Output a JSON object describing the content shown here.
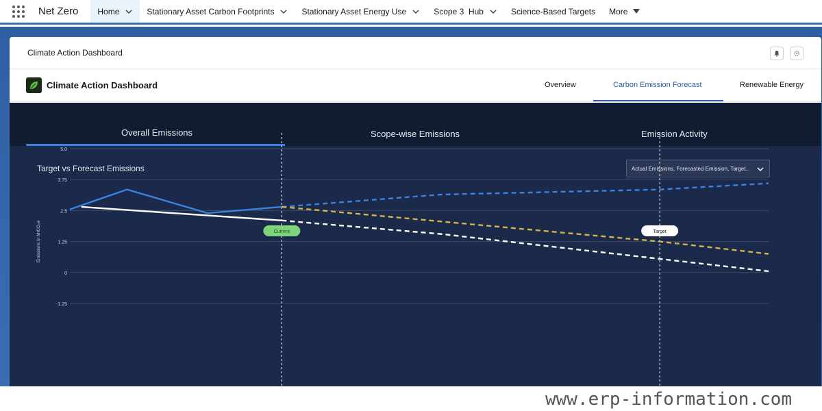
{
  "topnav": {
    "app_name": "Net Zero",
    "items": [
      {
        "label": "Home",
        "has_chevron": true
      },
      {
        "label": "Stationary Asset Carbon Footprints",
        "has_chevron": true
      },
      {
        "label": "Stationary Asset Energy Use",
        "has_chevron": true
      },
      {
        "label": "Scope 3  Hub",
        "has_chevron": true
      },
      {
        "label": "Science-Based Targets",
        "has_chevron": false
      },
      {
        "label": "More",
        "has_chevron": true
      }
    ]
  },
  "card": {
    "title": "Climate Action Dashboard",
    "icons": [
      "bell-icon",
      "settings-icon"
    ]
  },
  "dashboard": {
    "title": "Climate Action Dashboard",
    "logo_icon": "leaf-icon",
    "tabs": [
      {
        "label": "Overview",
        "active": false
      },
      {
        "label": "Carbon Emission Forecast",
        "active": true
      },
      {
        "label": "Renewable Energy",
        "active": false
      }
    ]
  },
  "subtabs": [
    {
      "label": "Overall Emissions",
      "active": true
    },
    {
      "label": "Scope-wise Emissions",
      "active": false
    },
    {
      "label": "Emission Activity",
      "active": false
    }
  ],
  "chart_section": {
    "title": "Target vs Forecast Emissions",
    "filter_value": "Actual Emissions, Forecasted Emission, Target.."
  },
  "chart_data": {
    "type": "line",
    "ylabel": "Emissions In MtCO₂e",
    "yticks": [
      "5.0",
      "3.75",
      "2.5",
      "1.25",
      "0",
      "-1.25"
    ],
    "ylim": [
      -1.25,
      5.0
    ],
    "x": [
      0,
      1,
      2,
      3,
      4,
      5,
      6,
      7,
      8,
      9,
      10,
      11,
      12
    ],
    "markers": [
      {
        "label": "Current",
        "x": 3.7
      },
      {
        "label": "Target",
        "x": 10.3
      }
    ],
    "series": [
      {
        "style": "solid",
        "color": "#3a82e0",
        "points": [
          [
            0,
            2.55
          ],
          [
            1,
            3.35
          ],
          [
            2.4,
            2.4
          ],
          [
            3.7,
            2.65
          ]
        ]
      },
      {
        "style": "dashed",
        "color": "#3a82e0",
        "points": [
          [
            3.7,
            2.65
          ],
          [
            6.5,
            3.15
          ],
          [
            10.3,
            3.35
          ],
          [
            12.2,
            3.6
          ]
        ]
      },
      {
        "style": "solid",
        "color": "#ffffff",
        "points": [
          [
            0.2,
            2.65
          ],
          [
            3.7,
            2.1
          ]
        ]
      },
      {
        "style": "dashed",
        "color": "#ffffff",
        "points": [
          [
            3.7,
            2.1
          ],
          [
            6.5,
            1.55
          ],
          [
            10.3,
            0.55
          ],
          [
            12.2,
            0.05
          ]
        ]
      },
      {
        "style": "dashed",
        "color": "#d8b24a",
        "points": [
          [
            3.7,
            2.65
          ],
          [
            10.3,
            1.25
          ],
          [
            12.2,
            0.75
          ]
        ]
      }
    ]
  },
  "watermark": "www.erp-information.com"
}
